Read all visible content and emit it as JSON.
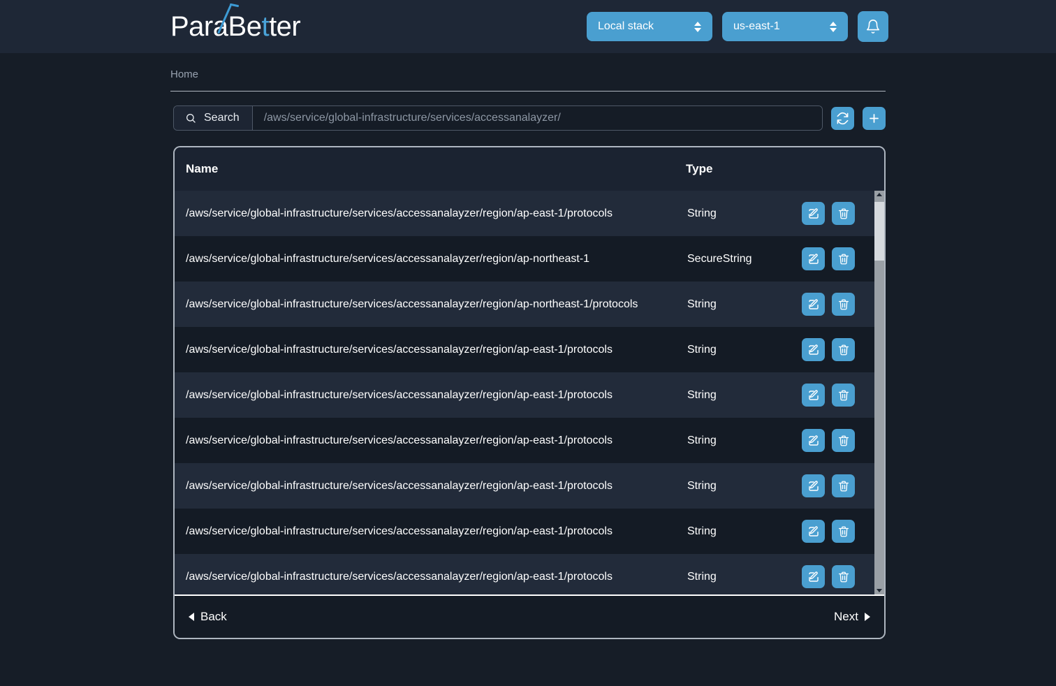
{
  "header": {
    "logo": {
      "prefix": "Para",
      "mid": "B",
      "accent_letter": "t",
      "suffix_a": "e",
      "suffix_b": "ter"
    },
    "stack_select": {
      "value": "Local stack"
    },
    "region_select": {
      "value": "us-east-1"
    },
    "notifications_icon": "bell-icon",
    "accent_color": "#4a9fd0"
  },
  "breadcrumb": {
    "home": "Home"
  },
  "search": {
    "button_label": "Search",
    "placeholder": "/aws/service/global-infrastructure/services/accessanalayzer/",
    "value": "",
    "refresh_icon": "refresh-icon",
    "add_icon": "plus-icon"
  },
  "table": {
    "columns": {
      "name": "Name",
      "type": "Type"
    },
    "rows": [
      {
        "name": "/aws/service/global-infrastructure/services/accessanalayzer/region/ap-east-1/protocols",
        "type": "String"
      },
      {
        "name": "/aws/service/global-infrastructure/services/accessanalayzer/region/ap-northeast-1",
        "type": "SecureString"
      },
      {
        "name": "/aws/service/global-infrastructure/services/accessanalayzer/region/ap-northeast-1/protocols",
        "type": "String"
      },
      {
        "name": "/aws/service/global-infrastructure/services/accessanalayzer/region/ap-east-1/protocols",
        "type": "String"
      },
      {
        "name": "/aws/service/global-infrastructure/services/accessanalayzer/region/ap-east-1/protocols",
        "type": "String"
      },
      {
        "name": "/aws/service/global-infrastructure/services/accessanalayzer/region/ap-east-1/protocols",
        "type": "String"
      },
      {
        "name": "/aws/service/global-infrastructure/services/accessanalayzer/region/ap-east-1/protocols",
        "type": "String"
      },
      {
        "name": "/aws/service/global-infrastructure/services/accessanalayzer/region/ap-east-1/protocols",
        "type": "String"
      },
      {
        "name": "/aws/service/global-infrastructure/services/accessanalayzer/region/ap-east-1/protocols",
        "type": "String"
      }
    ],
    "row_actions": {
      "edit_icon": "edit-icon",
      "delete_icon": "trash-icon"
    }
  },
  "pagination": {
    "back": "Back",
    "next": "Next"
  }
}
